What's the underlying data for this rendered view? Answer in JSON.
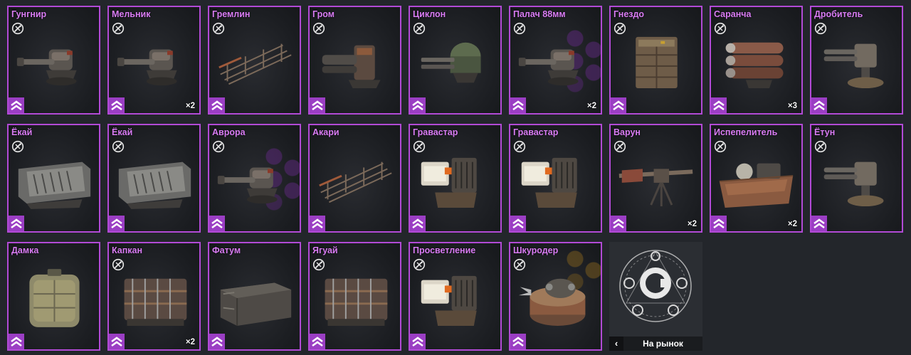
{
  "colors": {
    "accent": "#b24ad6",
    "name_text": "#d97cf4",
    "background": "#23262b"
  },
  "items": [
    {
      "name": "Гунгнир",
      "qty": "",
      "badge": "crossed-out-icon",
      "art": "cannon",
      "bg": ""
    },
    {
      "name": "Мельник",
      "qty": "×2",
      "badge": "crossed-out-icon",
      "art": "cannon",
      "bg": ""
    },
    {
      "name": "Гремлин",
      "qty": "",
      "badge": "crossed-out-icon",
      "art": "frame",
      "bg": ""
    },
    {
      "name": "Гром",
      "qty": "",
      "badge": "crossed-out-icon",
      "art": "gatling",
      "bg": ""
    },
    {
      "name": "Циклон",
      "qty": "",
      "badge": "crossed-out-icon",
      "art": "dome",
      "bg": ""
    },
    {
      "name": "Палач 88мм",
      "qty": "×2",
      "badge": "crossed-out-icon",
      "art": "cannon",
      "bg": "hex"
    },
    {
      "name": "Гнездо",
      "qty": "",
      "badge": "crossed-out-icon",
      "art": "box",
      "bg": ""
    },
    {
      "name": "Саранча",
      "qty": "×3",
      "badge": "crossed-out-icon",
      "art": "launcher",
      "bg": ""
    },
    {
      "name": "Дробитель",
      "qty": "",
      "badge": "crossed-out-icon",
      "art": "turret",
      "bg": ""
    },
    {
      "name": "Ёкай",
      "qty": "",
      "badge": "crossed-out-icon",
      "art": "block",
      "bg": ""
    },
    {
      "name": "Ёкай",
      "qty": "",
      "badge": "crossed-out-icon",
      "art": "block",
      "bg": ""
    },
    {
      "name": "Аврора",
      "qty": "",
      "badge": "crossed-out-icon",
      "art": "cannon",
      "bg": "hex"
    },
    {
      "name": "Акари",
      "qty": "",
      "badge": "",
      "art": "frame",
      "bg": ""
    },
    {
      "name": "Гравастар",
      "qty": "",
      "badge": "crossed-out-icon",
      "art": "mech",
      "bg": ""
    },
    {
      "name": "Гравастар",
      "qty": "",
      "badge": "crossed-out-icon",
      "art": "mech",
      "bg": ""
    },
    {
      "name": "Варун",
      "qty": "×2",
      "badge": "crossed-out-icon",
      "art": "crossbow",
      "bg": ""
    },
    {
      "name": "Испепелитель",
      "qty": "×2",
      "badge": "crossed-out-icon",
      "art": "tub",
      "bg": ""
    },
    {
      "name": "Ётун",
      "qty": "",
      "badge": "crossed-out-icon",
      "art": "turret",
      "bg": ""
    },
    {
      "name": "Дамка",
      "qty": "",
      "badge": "",
      "art": "tank",
      "bg": ""
    },
    {
      "name": "Капкан",
      "qty": "×2",
      "badge": "crossed-out-icon",
      "art": "cage",
      "bg": ""
    },
    {
      "name": "Фатум",
      "qty": "",
      "badge": "",
      "art": "crate",
      "bg": ""
    },
    {
      "name": "Ягуай",
      "qty": "",
      "badge": "crossed-out-icon",
      "art": "cage",
      "bg": ""
    },
    {
      "name": "Просветление",
      "qty": "",
      "badge": "crossed-out-icon",
      "art": "mech",
      "bg": ""
    },
    {
      "name": "Шкуродер",
      "qty": "",
      "badge": "crossed-out-icon",
      "art": "drum",
      "bg": "hex-gold"
    }
  ],
  "market": {
    "label": "На рынок",
    "back_icon": "chevron-left-icon",
    "logo_icon": "crossout-logo-icon"
  }
}
